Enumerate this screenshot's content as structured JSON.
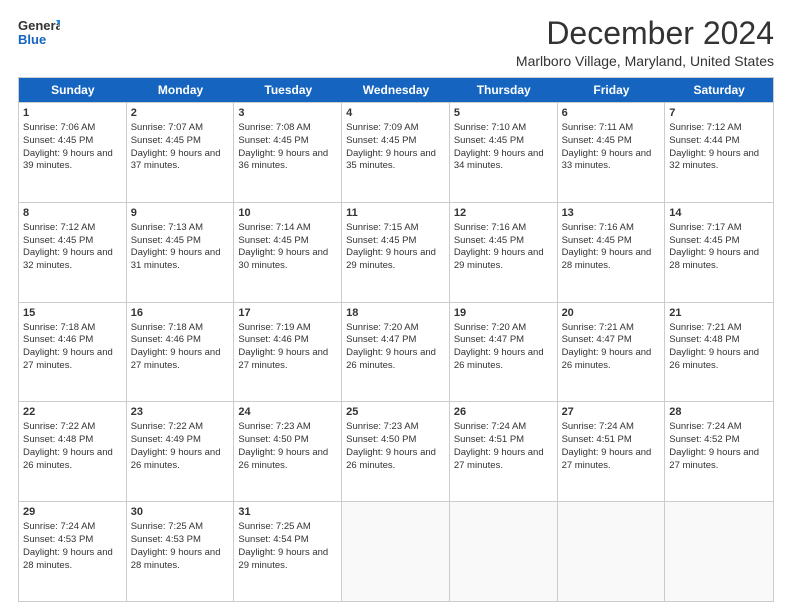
{
  "header": {
    "logo_general": "General",
    "logo_blue": "Blue",
    "month_title": "December 2024",
    "location": "Marlboro Village, Maryland, United States"
  },
  "days_of_week": [
    "Sunday",
    "Monday",
    "Tuesday",
    "Wednesday",
    "Thursday",
    "Friday",
    "Saturday"
  ],
  "weeks": [
    [
      {
        "day": "1",
        "sunrise": "Sunrise: 7:06 AM",
        "sunset": "Sunset: 4:45 PM",
        "daylight": "Daylight: 9 hours and 39 minutes."
      },
      {
        "day": "2",
        "sunrise": "Sunrise: 7:07 AM",
        "sunset": "Sunset: 4:45 PM",
        "daylight": "Daylight: 9 hours and 37 minutes."
      },
      {
        "day": "3",
        "sunrise": "Sunrise: 7:08 AM",
        "sunset": "Sunset: 4:45 PM",
        "daylight": "Daylight: 9 hours and 36 minutes."
      },
      {
        "day": "4",
        "sunrise": "Sunrise: 7:09 AM",
        "sunset": "Sunset: 4:45 PM",
        "daylight": "Daylight: 9 hours and 35 minutes."
      },
      {
        "day": "5",
        "sunrise": "Sunrise: 7:10 AM",
        "sunset": "Sunset: 4:45 PM",
        "daylight": "Daylight: 9 hours and 34 minutes."
      },
      {
        "day": "6",
        "sunrise": "Sunrise: 7:11 AM",
        "sunset": "Sunset: 4:45 PM",
        "daylight": "Daylight: 9 hours and 33 minutes."
      },
      {
        "day": "7",
        "sunrise": "Sunrise: 7:12 AM",
        "sunset": "Sunset: 4:44 PM",
        "daylight": "Daylight: 9 hours and 32 minutes."
      }
    ],
    [
      {
        "day": "8",
        "sunrise": "Sunrise: 7:12 AM",
        "sunset": "Sunset: 4:45 PM",
        "daylight": "Daylight: 9 hours and 32 minutes."
      },
      {
        "day": "9",
        "sunrise": "Sunrise: 7:13 AM",
        "sunset": "Sunset: 4:45 PM",
        "daylight": "Daylight: 9 hours and 31 minutes."
      },
      {
        "day": "10",
        "sunrise": "Sunrise: 7:14 AM",
        "sunset": "Sunset: 4:45 PM",
        "daylight": "Daylight: 9 hours and 30 minutes."
      },
      {
        "day": "11",
        "sunrise": "Sunrise: 7:15 AM",
        "sunset": "Sunset: 4:45 PM",
        "daylight": "Daylight: 9 hours and 29 minutes."
      },
      {
        "day": "12",
        "sunrise": "Sunrise: 7:16 AM",
        "sunset": "Sunset: 4:45 PM",
        "daylight": "Daylight: 9 hours and 29 minutes."
      },
      {
        "day": "13",
        "sunrise": "Sunrise: 7:16 AM",
        "sunset": "Sunset: 4:45 PM",
        "daylight": "Daylight: 9 hours and 28 minutes."
      },
      {
        "day": "14",
        "sunrise": "Sunrise: 7:17 AM",
        "sunset": "Sunset: 4:45 PM",
        "daylight": "Daylight: 9 hours and 28 minutes."
      }
    ],
    [
      {
        "day": "15",
        "sunrise": "Sunrise: 7:18 AM",
        "sunset": "Sunset: 4:46 PM",
        "daylight": "Daylight: 9 hours and 27 minutes."
      },
      {
        "day": "16",
        "sunrise": "Sunrise: 7:18 AM",
        "sunset": "Sunset: 4:46 PM",
        "daylight": "Daylight: 9 hours and 27 minutes."
      },
      {
        "day": "17",
        "sunrise": "Sunrise: 7:19 AM",
        "sunset": "Sunset: 4:46 PM",
        "daylight": "Daylight: 9 hours and 27 minutes."
      },
      {
        "day": "18",
        "sunrise": "Sunrise: 7:20 AM",
        "sunset": "Sunset: 4:47 PM",
        "daylight": "Daylight: 9 hours and 26 minutes."
      },
      {
        "day": "19",
        "sunrise": "Sunrise: 7:20 AM",
        "sunset": "Sunset: 4:47 PM",
        "daylight": "Daylight: 9 hours and 26 minutes."
      },
      {
        "day": "20",
        "sunrise": "Sunrise: 7:21 AM",
        "sunset": "Sunset: 4:47 PM",
        "daylight": "Daylight: 9 hours and 26 minutes."
      },
      {
        "day": "21",
        "sunrise": "Sunrise: 7:21 AM",
        "sunset": "Sunset: 4:48 PM",
        "daylight": "Daylight: 9 hours and 26 minutes."
      }
    ],
    [
      {
        "day": "22",
        "sunrise": "Sunrise: 7:22 AM",
        "sunset": "Sunset: 4:48 PM",
        "daylight": "Daylight: 9 hours and 26 minutes."
      },
      {
        "day": "23",
        "sunrise": "Sunrise: 7:22 AM",
        "sunset": "Sunset: 4:49 PM",
        "daylight": "Daylight: 9 hours and 26 minutes."
      },
      {
        "day": "24",
        "sunrise": "Sunrise: 7:23 AM",
        "sunset": "Sunset: 4:50 PM",
        "daylight": "Daylight: 9 hours and 26 minutes."
      },
      {
        "day": "25",
        "sunrise": "Sunrise: 7:23 AM",
        "sunset": "Sunset: 4:50 PM",
        "daylight": "Daylight: 9 hours and 26 minutes."
      },
      {
        "day": "26",
        "sunrise": "Sunrise: 7:24 AM",
        "sunset": "Sunset: 4:51 PM",
        "daylight": "Daylight: 9 hours and 27 minutes."
      },
      {
        "day": "27",
        "sunrise": "Sunrise: 7:24 AM",
        "sunset": "Sunset: 4:51 PM",
        "daylight": "Daylight: 9 hours and 27 minutes."
      },
      {
        "day": "28",
        "sunrise": "Sunrise: 7:24 AM",
        "sunset": "Sunset: 4:52 PM",
        "daylight": "Daylight: 9 hours and 27 minutes."
      }
    ],
    [
      {
        "day": "29",
        "sunrise": "Sunrise: 7:24 AM",
        "sunset": "Sunset: 4:53 PM",
        "daylight": "Daylight: 9 hours and 28 minutes."
      },
      {
        "day": "30",
        "sunrise": "Sunrise: 7:25 AM",
        "sunset": "Sunset: 4:53 PM",
        "daylight": "Daylight: 9 hours and 28 minutes."
      },
      {
        "day": "31",
        "sunrise": "Sunrise: 7:25 AM",
        "sunset": "Sunset: 4:54 PM",
        "daylight": "Daylight: 9 hours and 29 minutes."
      },
      {
        "day": "",
        "sunrise": "",
        "sunset": "",
        "daylight": ""
      },
      {
        "day": "",
        "sunrise": "",
        "sunset": "",
        "daylight": ""
      },
      {
        "day": "",
        "sunrise": "",
        "sunset": "",
        "daylight": ""
      },
      {
        "day": "",
        "sunrise": "",
        "sunset": "",
        "daylight": ""
      }
    ]
  ]
}
